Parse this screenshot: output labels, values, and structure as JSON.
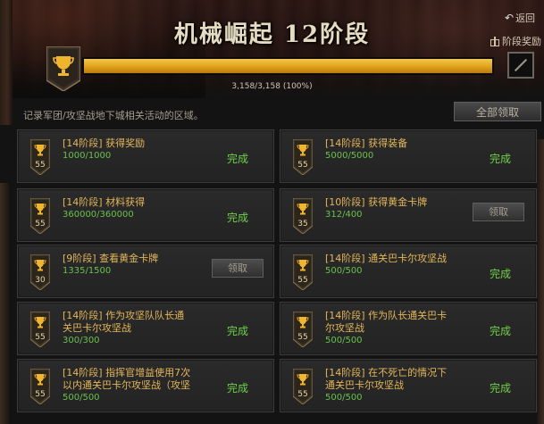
{
  "header": {
    "title": "机械崛起  12阶段",
    "back_label": "返回",
    "stage_reward_label": "阶段奖励",
    "progress_text": "3,158/3,158 (100%)",
    "progress_fraction": 1.0
  },
  "description": "记录军团/攻坚战地下城相关活动的区域。",
  "claim_all_label": "全部领取",
  "colors": {
    "accent_gold": "#e3b75a",
    "complete_green": "#6fd04b",
    "progress_green": "#6bc04e",
    "progress_bar": "#f0b52e"
  },
  "achievements": [
    {
      "badge": "55",
      "title_lines": [
        "[14阶段] 获得奖励"
      ],
      "progress": "1000/1000",
      "status": "完成",
      "action": "done"
    },
    {
      "badge": "55",
      "title_lines": [
        "[14阶段] 获得装备"
      ],
      "progress": "5000/5000",
      "status": "完成",
      "action": "done"
    },
    {
      "badge": "55",
      "title_lines": [
        "[14阶段] 材料获得"
      ],
      "progress": "360000/360000",
      "status": "完成",
      "action": "done"
    },
    {
      "badge": "35",
      "title_lines": [
        "[10阶段] 获得黄金卡牌"
      ],
      "progress": "312/400",
      "status": "领取",
      "action": "claim"
    },
    {
      "badge": "30",
      "title_lines": [
        "[9阶段] 查看黄金卡牌"
      ],
      "progress": "1335/1500",
      "status": "领取",
      "action": "claim"
    },
    {
      "badge": "55",
      "title_lines": [
        "[14阶段] 通关巴卡尔攻坚战"
      ],
      "progress": "500/500",
      "status": "完成",
      "action": "done"
    },
    {
      "badge": "55",
      "title_lines": [
        "[14阶段] 作为攻坚队队长通",
        "关巴卡尔攻坚战"
      ],
      "progress": "300/300",
      "status": "完成",
      "action": "done"
    },
    {
      "badge": "55",
      "title_lines": [
        "[14阶段] 作为队长通关巴卡",
        "尔攻坚战"
      ],
      "progress": "500/500",
      "status": "完成",
      "action": "done"
    },
    {
      "badge": "55",
      "title_lines": [
        "[14阶段] 指挥官增益使用7次",
        "以内通关巴卡尔攻坚战（攻坚"
      ],
      "progress": "500/500",
      "status": "完成",
      "action": "done"
    },
    {
      "badge": "55",
      "title_lines": [
        "[14阶段] 在不死亡的情况下",
        "通关巴卡尔攻坚战"
      ],
      "progress": "500/500",
      "status": "完成",
      "action": "done"
    }
  ]
}
